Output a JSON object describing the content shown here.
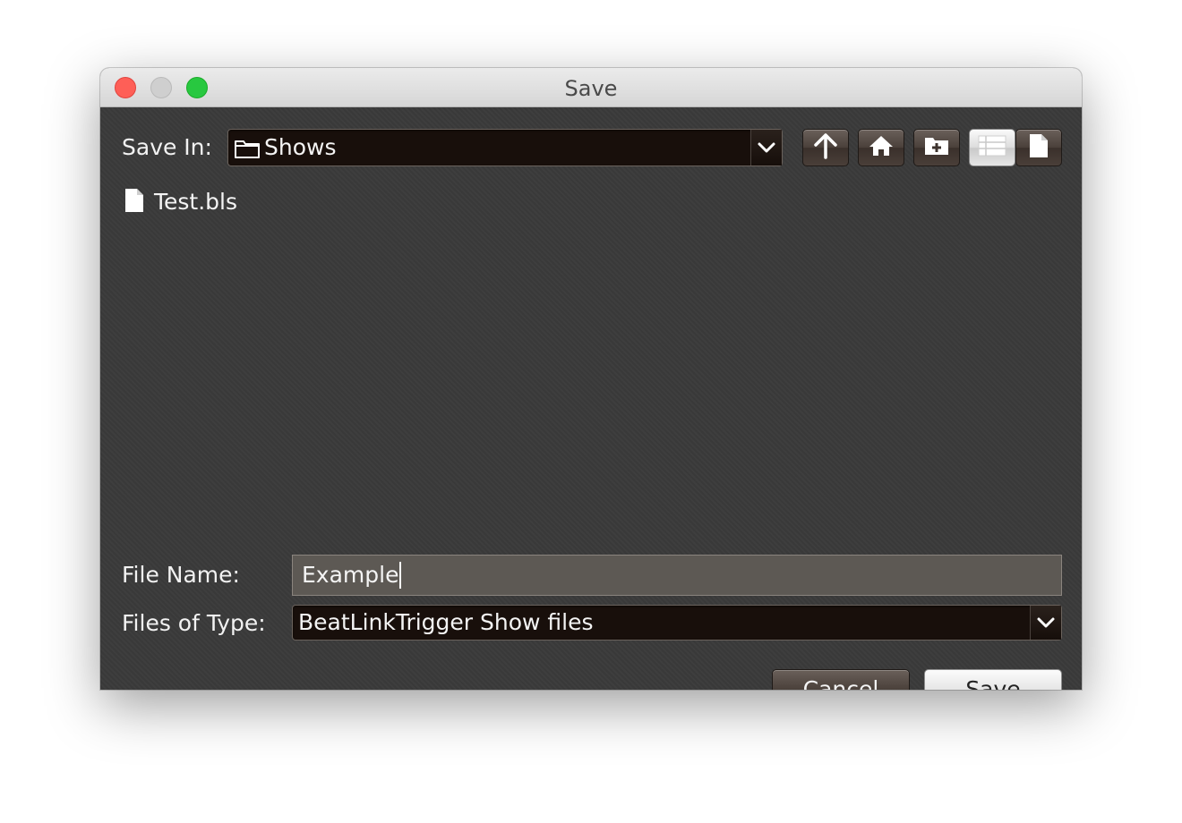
{
  "window": {
    "title": "Save"
  },
  "colors": {
    "close": "#fe5f57",
    "minimize": "#cfcfcf",
    "zoom": "#28c840",
    "background": "#3a3a3a"
  },
  "save_in": {
    "label": "Save In:",
    "value": "Shows",
    "icon": "folder-icon"
  },
  "toolbar": {
    "buttons": [
      {
        "name": "up-one-level",
        "icon": "arrow-up-icon"
      },
      {
        "name": "home",
        "icon": "home-icon"
      },
      {
        "name": "new-folder",
        "icon": "new-folder-icon"
      },
      {
        "name": "list-view",
        "icon": "list-icon",
        "selected": true
      },
      {
        "name": "details-view",
        "icon": "document-icon",
        "selected": false
      }
    ]
  },
  "files": [
    {
      "name": "Test.bls",
      "icon": "file-icon"
    }
  ],
  "file_name": {
    "label": "File Name:",
    "value": "Example"
  },
  "file_type": {
    "label": "Files of Type:",
    "value": "BeatLinkTrigger Show files"
  },
  "buttons": {
    "cancel": "Cancel",
    "save": "Save"
  }
}
